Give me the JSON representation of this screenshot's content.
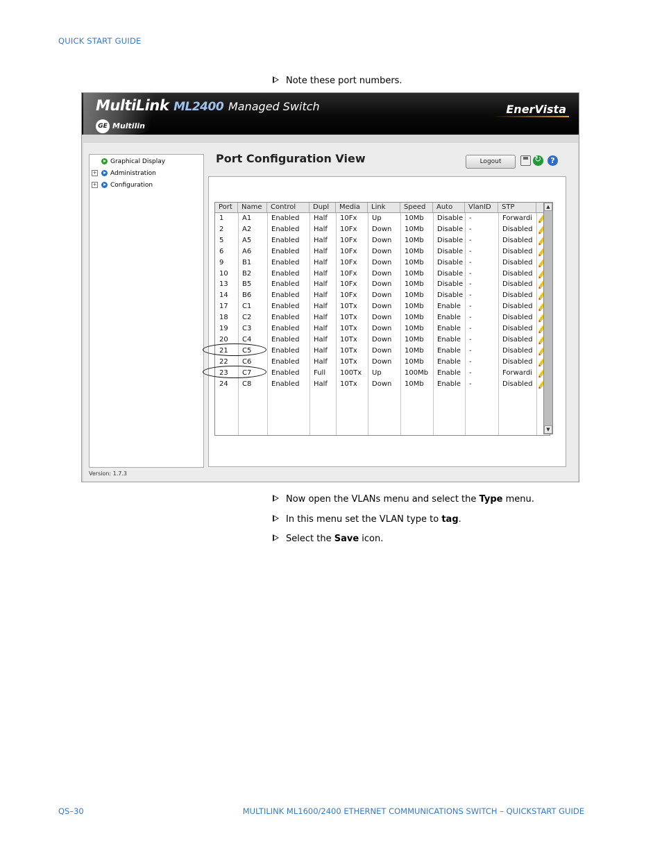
{
  "page": {
    "header": "QUICK START GUIDE",
    "footer_left": "QS–30",
    "footer_right": "MULTILINK ML1600/2400 ETHERNET COMMUNICATIONS SWITCH – QUICKSTART GUIDE"
  },
  "steps": {
    "s1": "Note these port numbers.",
    "s2_pre": "Now open the VLANs menu and select the ",
    "s2_bold": "Type",
    "s2_post": " menu.",
    "s3_pre": "In this menu set the VLAN type to ",
    "s3_bold": "tag",
    "s3_post": ".",
    "s4_pre": "Select the ",
    "s4_bold": "Save",
    "s4_post": " icon."
  },
  "app": {
    "brand_multilink": "MultiLink",
    "brand_model": "ML2400",
    "brand_suffix": "Managed Switch",
    "multilin": "Multilin",
    "ge": "GE",
    "enervista": "EnerVista",
    "nav": [
      "Graphical Display",
      "Administration",
      "Configuration"
    ],
    "version": "Version: 1.7.3",
    "view_title": "Port Configuration View",
    "logout": "Logout",
    "icons": {
      "save": "save-icon",
      "refresh": "refresh-icon",
      "help": "help-icon"
    }
  },
  "table": {
    "headers": [
      "Port",
      "Name",
      "Control",
      "Dupl",
      "Media",
      "Link",
      "Speed",
      "Auto",
      "VlanID",
      "STP",
      ""
    ],
    "rows": [
      [
        "1",
        "A1",
        "Enabled",
        "Half",
        "10Fx",
        "Up",
        "10Mb",
        "Disable",
        "-",
        "Forwardi"
      ],
      [
        "2",
        "A2",
        "Enabled",
        "Half",
        "10Fx",
        "Down",
        "10Mb",
        "Disable",
        "-",
        "Disabled"
      ],
      [
        "5",
        "A5",
        "Enabled",
        "Half",
        "10Fx",
        "Down",
        "10Mb",
        "Disable",
        "-",
        "Disabled"
      ],
      [
        "6",
        "A6",
        "Enabled",
        "Half",
        "10Fx",
        "Down",
        "10Mb",
        "Disable",
        "-",
        "Disabled"
      ],
      [
        "9",
        "B1",
        "Enabled",
        "Half",
        "10Fx",
        "Down",
        "10Mb",
        "Disable",
        "-",
        "Disabled"
      ],
      [
        "10",
        "B2",
        "Enabled",
        "Half",
        "10Fx",
        "Down",
        "10Mb",
        "Disable",
        "-",
        "Disabled"
      ],
      [
        "13",
        "B5",
        "Enabled",
        "Half",
        "10Fx",
        "Down",
        "10Mb",
        "Disable",
        "-",
        "Disabled"
      ],
      [
        "14",
        "B6",
        "Enabled",
        "Half",
        "10Fx",
        "Down",
        "10Mb",
        "Disable",
        "-",
        "Disabled"
      ],
      [
        "17",
        "C1",
        "Enabled",
        "Half",
        "10Tx",
        "Down",
        "10Mb",
        "Enable",
        "-",
        "Disabled"
      ],
      [
        "18",
        "C2",
        "Enabled",
        "Half",
        "10Tx",
        "Down",
        "10Mb",
        "Enable",
        "-",
        "Disabled"
      ],
      [
        "19",
        "C3",
        "Enabled",
        "Half",
        "10Tx",
        "Down",
        "10Mb",
        "Enable",
        "-",
        "Disabled"
      ],
      [
        "20",
        "C4",
        "Enabled",
        "Half",
        "10Tx",
        "Down",
        "10Mb",
        "Enable",
        "-",
        "Disabled"
      ],
      [
        "21",
        "C5",
        "Enabled",
        "Half",
        "10Tx",
        "Down",
        "10Mb",
        "Enable",
        "-",
        "Disabled"
      ],
      [
        "22",
        "C6",
        "Enabled",
        "Half",
        "10Tx",
        "Down",
        "10Mb",
        "Enable",
        "-",
        "Disabled"
      ],
      [
        "23",
        "C7",
        "Enabled",
        "Full",
        "100Tx",
        "Up",
        "100Mb",
        "Enable",
        "-",
        "Forwardi"
      ],
      [
        "24",
        "C8",
        "Enabled",
        "Half",
        "10Tx",
        "Down",
        "10Mb",
        "Enable",
        "-",
        "Disabled"
      ]
    ],
    "circled_ports": [
      "21",
      "23"
    ]
  }
}
